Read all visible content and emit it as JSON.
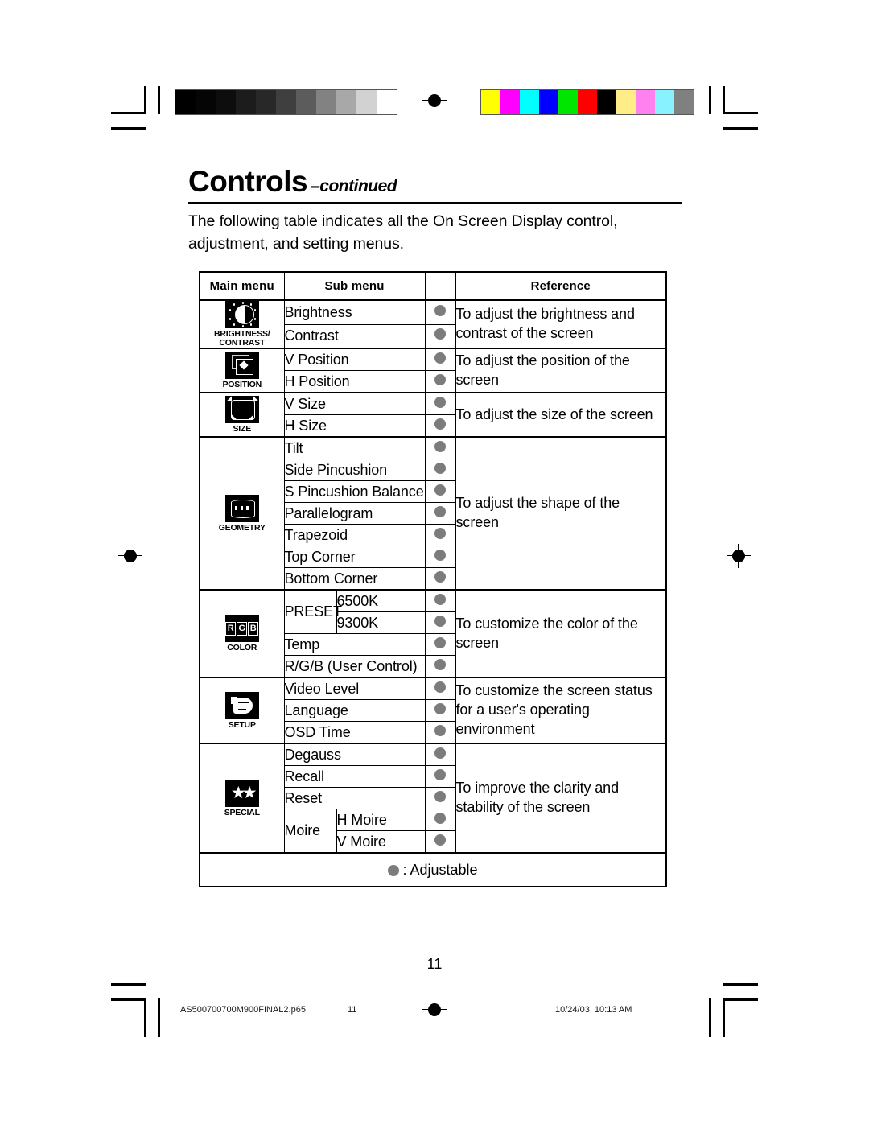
{
  "heading": {
    "title": "Controls",
    "subtitle": "–continued"
  },
  "intro": "The following table indicates all the On Screen Display control, adjustment, and setting menus.",
  "table": {
    "headers": {
      "main_menu": "Main menu",
      "sub_menu": "Sub menu",
      "dot": "",
      "reference": "Reference"
    },
    "sections": [
      {
        "icon": "brightness-contrast-icon",
        "menu_label_line1": "BRIGHTNESS/",
        "menu_label_line2": "CONTRAST",
        "reference": "To adjust the brightness and contrast of the screen",
        "rows": [
          {
            "sub": "Brightness",
            "adjustable": true
          },
          {
            "sub": "Contrast",
            "adjustable": true
          }
        ]
      },
      {
        "icon": "position-icon",
        "menu_label_line1": "POSITION",
        "menu_label_line2": "",
        "reference": "To adjust the position of the screen",
        "rows": [
          {
            "sub": "V Position",
            "adjustable": true
          },
          {
            "sub": "H Position",
            "adjustable": true
          }
        ]
      },
      {
        "icon": "size-icon",
        "menu_label_line1": "SIZE",
        "menu_label_line2": "",
        "reference": "To adjust the size of the screen",
        "rows": [
          {
            "sub": "V Size",
            "adjustable": true
          },
          {
            "sub": "H Size",
            "adjustable": true
          }
        ]
      },
      {
        "icon": "geometry-icon",
        "menu_label_line1": "GEOMETRY",
        "menu_label_line2": "",
        "reference": "To adjust the shape of the screen",
        "rows": [
          {
            "sub": "Tilt",
            "adjustable": true
          },
          {
            "sub": "Side Pincushion",
            "adjustable": true
          },
          {
            "sub": "S Pincushion Balance",
            "adjustable": true
          },
          {
            "sub": "Parallelogram",
            "adjustable": true
          },
          {
            "sub": "Trapezoid",
            "adjustable": true
          },
          {
            "sub": "Top Corner",
            "adjustable": true
          },
          {
            "sub": "Bottom Corner",
            "adjustable": true
          }
        ]
      },
      {
        "icon": "color-rgb-icon",
        "menu_label_line1": "COLOR",
        "menu_label_line2": "",
        "reference": "To customize the color of the screen",
        "rows": [
          {
            "sub": "PRESET",
            "sub2": "6500K",
            "adjustable": true
          },
          {
            "sub": "",
            "sub2": "9300K",
            "adjustable": true
          },
          {
            "sub": "Temp",
            "adjustable": true
          },
          {
            "sub": "R/G/B (User Control)",
            "adjustable": true
          }
        ]
      },
      {
        "icon": "setup-hand-icon",
        "menu_label_line1": "SETUP",
        "menu_label_line2": "",
        "reference": "To customize the screen status for a user's operating environment",
        "rows": [
          {
            "sub": "Video Level",
            "adjustable": true
          },
          {
            "sub": "Language",
            "adjustable": true
          },
          {
            "sub": "OSD Time",
            "adjustable": true
          }
        ]
      },
      {
        "icon": "special-star-icon",
        "menu_label_line1": "SPECIAL",
        "menu_label_line2": "",
        "reference": "To improve the clarity and stability of the screen",
        "rows": [
          {
            "sub": "Degauss",
            "adjustable": true
          },
          {
            "sub": "Recall",
            "adjustable": true
          },
          {
            "sub": "Reset",
            "adjustable": true
          },
          {
            "sub": "Moire",
            "sub2": "H Moire",
            "adjustable": true
          },
          {
            "sub": "",
            "sub2": "V Moire",
            "adjustable": true
          }
        ]
      }
    ],
    "legend": ": Adjustable"
  },
  "page_number": "11",
  "footer": {
    "file": "AS500700700M900FINAL2.p65",
    "page": "11",
    "date": "10/24/03, 10:13 AM"
  },
  "print_bars": {
    "grayscale": [
      "#000000",
      "#050505",
      "#0d0d0d",
      "#1c1c1c",
      "#282828",
      "#3f3f3f",
      "#5c5c5c",
      "#828282",
      "#a8a8a8",
      "#d2d2d2",
      "#ffffff"
    ],
    "colors": [
      "#ffff00",
      "#ff00ff",
      "#00ffff",
      "#0000ff",
      "#00e600",
      "#ff0000",
      "#000000",
      "#ffee88",
      "#ff80ef",
      "#88f2ff",
      "#808080"
    ]
  }
}
